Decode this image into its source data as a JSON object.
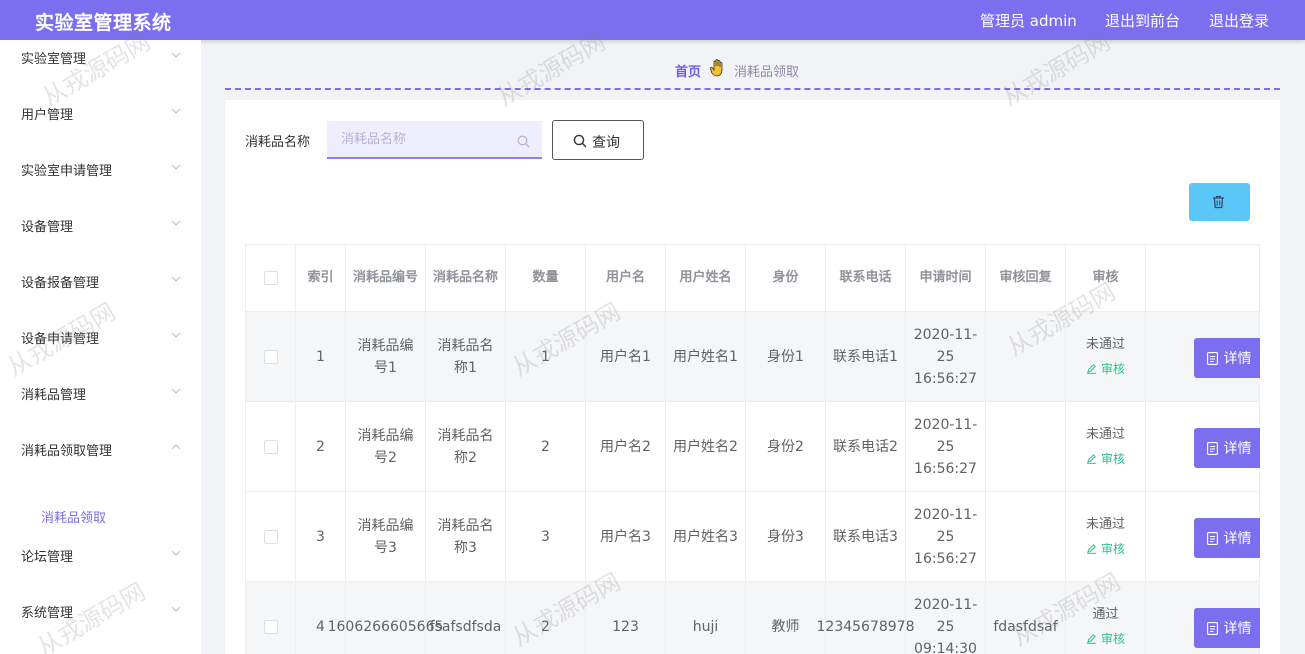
{
  "header": {
    "app_title": "实验室管理系统",
    "admin_label": "管理员 admin",
    "exit_front_label": "退出到前台",
    "logout_label": "退出登录",
    "color": "#7b6ff0"
  },
  "sidebar": {
    "items": [
      {
        "label": "实验室管理"
      },
      {
        "label": "用户管理"
      },
      {
        "label": "实验室申请管理"
      },
      {
        "label": "设备管理"
      },
      {
        "label": "设备报备管理"
      },
      {
        "label": "设备申请管理"
      },
      {
        "label": "消耗品管理"
      },
      {
        "label": "消耗品领取管理",
        "expanded": true
      },
      {
        "label": "论坛管理"
      },
      {
        "label": "系统管理"
      }
    ],
    "sub_item": "消耗品领取"
  },
  "breadcrumb": {
    "home": "首页",
    "separator_icon": "hand-icon",
    "current": "消耗品领取"
  },
  "search": {
    "label": "消耗品名称",
    "placeholder": "消耗品名称",
    "value": "",
    "button_label": "查询"
  },
  "toolbar": {
    "delete_icon": "trash-icon",
    "delete_color": "#5bc7f8"
  },
  "table": {
    "headers": [
      "索引",
      "消耗品编号",
      "消耗品名称",
      "数量",
      "用户名",
      "用户姓名",
      "身份",
      "联系电话",
      "申请时间",
      "审核回复",
      "审核"
    ],
    "review_link_label": "审核",
    "detail_label": "详情",
    "rows": [
      {
        "index": "1",
        "code": "消耗品编号1",
        "name": "消耗品名称1",
        "qty": "1",
        "username": "用户名1",
        "realname": "用户姓名1",
        "role": "身份1",
        "phone": "联系电话1",
        "time": "2020-11-25 16:56:27",
        "reply": "",
        "status": "未通过"
      },
      {
        "index": "2",
        "code": "消耗品编号2",
        "name": "消耗品名称2",
        "qty": "2",
        "username": "用户名2",
        "realname": "用户姓名2",
        "role": "身份2",
        "phone": "联系电话2",
        "time": "2020-11-25 16:56:27",
        "reply": "",
        "status": "未通过"
      },
      {
        "index": "3",
        "code": "消耗品编号3",
        "name": "消耗品名称3",
        "qty": "3",
        "username": "用户名3",
        "realname": "用户姓名3",
        "role": "身份3",
        "phone": "联系电话3",
        "time": "2020-11-25 16:56:27",
        "reply": "",
        "status": "未通过"
      },
      {
        "index": "4",
        "code": "1606266605665",
        "name": "fsafsdfsda",
        "qty": "2",
        "username": "123",
        "realname": "huji",
        "role": "教师",
        "phone": "12345678978",
        "time": "2020-11-25 09:14:30",
        "reply": "fdasfdsaf",
        "status": "通过"
      }
    ]
  },
  "watermark": "从戎源码网"
}
